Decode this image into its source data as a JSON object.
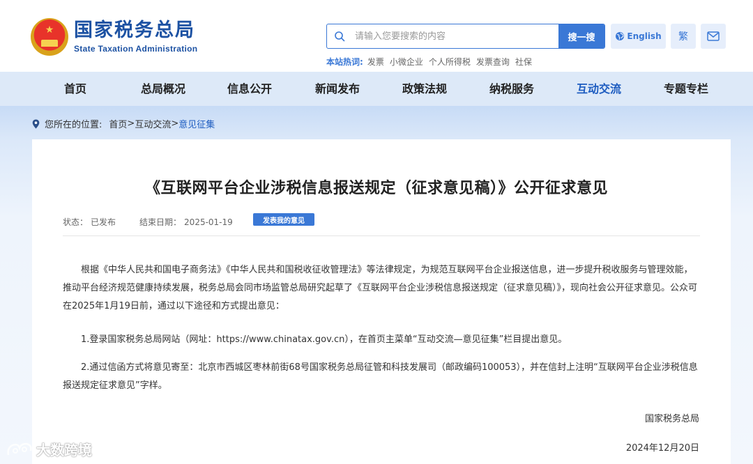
{
  "header": {
    "logo_cn": "国家税务总局",
    "logo_en": "State Taxation Administration",
    "search_placeholder": "请输入您要搜索的内容",
    "search_button": "搜一搜",
    "english_label": "English",
    "traditional_label": "繁",
    "hot_label": "本站热词:",
    "hot_words": [
      "发票",
      "小微企业",
      "个人所得税",
      "发票查询",
      "社保"
    ]
  },
  "nav": {
    "items": [
      "首页",
      "总局概况",
      "信息公开",
      "新闻发布",
      "政策法规",
      "纳税服务",
      "互动交流",
      "专题专栏"
    ],
    "active_index": 6
  },
  "breadcrumb": {
    "prefix": "您所在的位置:",
    "home": "首页",
    "section": "互动交流",
    "current": "意见征集"
  },
  "article": {
    "title": "《互联网平台企业涉税信息报送规定（征求意见稿）》公开征求意见",
    "status_label": "状态：",
    "status_value": "已发布",
    "end_label": "结束日期：",
    "end_value": "2025-01-19",
    "opinion_button": "发表我的意见",
    "p1": "根据《中华人民共和国电子商务法》《中华人民共和国税收征收管理法》等法律规定，为规范互联网平台企业报送信息，进一步提升税收服务与管理效能，推动平台经济规范健康持续发展，税务总局会同市场监管总局研究起草了《互联网平台企业涉税信息报送规定（征求意见稿）》，现向社会公开征求意见。公众可在2025年1月19日前，通过以下途径和方式提出意见：",
    "p2": "1.登录国家税务总局网站（网址：https://www.chinatax.gov.cn），在首页主菜单“互动交流—意见征集”栏目提出意见。",
    "p3": "2.通过信函方式将意见寄至：北京市西城区枣林前街68号国家税务总局征管和科技发展司（邮政编码100053），并在信封上注明“互联网平台企业涉税信息报送规定征求意见”字样。",
    "signature": "国家税务总局",
    "date": "2024年12月20日"
  },
  "watermark": "大数跨境",
  "colors": {
    "brand_blue": "#1d52a3",
    "accent_blue": "#3a78d6",
    "nav_bg": "#dde9f8"
  }
}
